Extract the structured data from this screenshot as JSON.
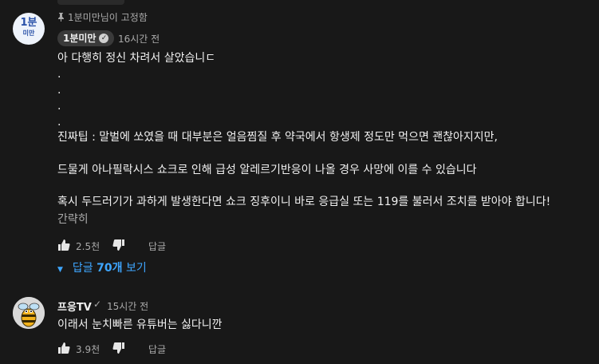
{
  "comment1": {
    "avatar_line1": "1분",
    "avatar_line2": "미만",
    "pinned_text": "1분미만님이 고정함",
    "author": "1분미만",
    "time": "16시간 전",
    "lines": [
      "아 다행히 정신 차려서 살았습니ㄷ",
      ".",
      ".",
      ".",
      ".",
      "진짜팁 : 말벌에 쏘였을 때 대부분은 얼음찜질 후 약국에서 항생제 정도만 먹으면 괜찮아지지만,",
      "드물게 아나필락시스 쇼크로 인해 급성 알레르기반응이 나올 경우 사망에 이를 수 있습니다",
      "혹시 두드러기가 과하게 발생한다면 쇼크 징후이니 바로 응급실 또는 119를 불러서 조치를 받아야 합니다!"
    ],
    "read_more": "간략히",
    "likes": "2.5천",
    "reply_label": "답글",
    "replies_prefix": "답글 ",
    "replies_count": "70개",
    "replies_suffix": " 보기"
  },
  "comment2": {
    "author": "프응TV",
    "check": "✓",
    "time": "15시간 전",
    "text": "이래서 눈치빠른 유튜버는 싫다니깐",
    "likes": "3.9천",
    "reply_label": "답글"
  },
  "colors": {
    "background": "#181818",
    "link": "#3ea6ff",
    "text": "#f1f1f1",
    "muted": "#aaaaaa"
  }
}
